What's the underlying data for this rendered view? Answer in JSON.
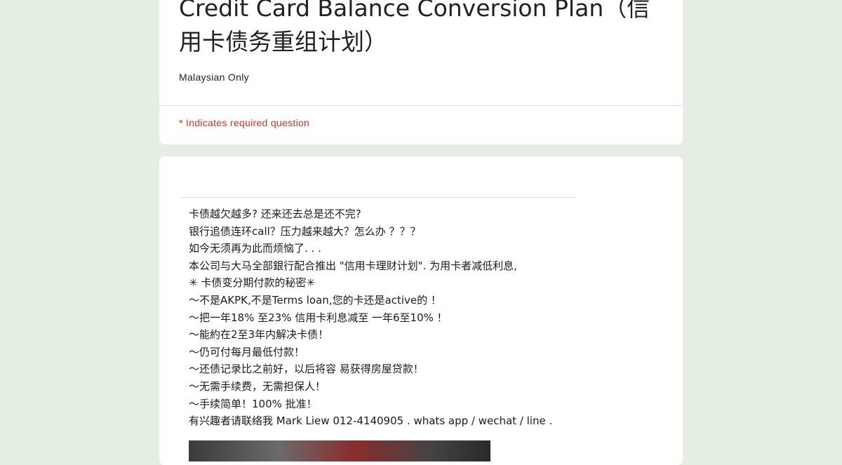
{
  "form": {
    "title": "Credit Card Balance Conversion Plan（信用卡债务重组计划）",
    "description": "Malaysian Only",
    "required_note": "* Indicates required question"
  },
  "promo": {
    "lines": [
      "卡债越欠越多? 还来还去总是还不完?",
      "银行追债连环call？压力越来越大？怎么办 ？？？",
      "如今无须再为此而烦恼了. . .",
      "本公司与大马全部銀行配合推出 \"信用卡理财计划\". 为用卡者减低利息,",
      "✳ 卡债变分期付款的秘密✳",
      "～不是AKPK,不是Terms loan,您的卡还是active的 ！",
      "～把一年18% 至23% 信用卡利息减至 一年6至10% ！",
      "～能約在2至3年内解决卡债！",
      "～仍可付每月最低付款！",
      "～还债记录比之前好，以后将容 易获得房屋贷款！",
      "～无需手续费，无需担保人！",
      "～手续简单！100% 批准！",
      "有兴趣者请联络我 Mark Liew 012-4140905 . whats app / wechat / line ."
    ]
  }
}
